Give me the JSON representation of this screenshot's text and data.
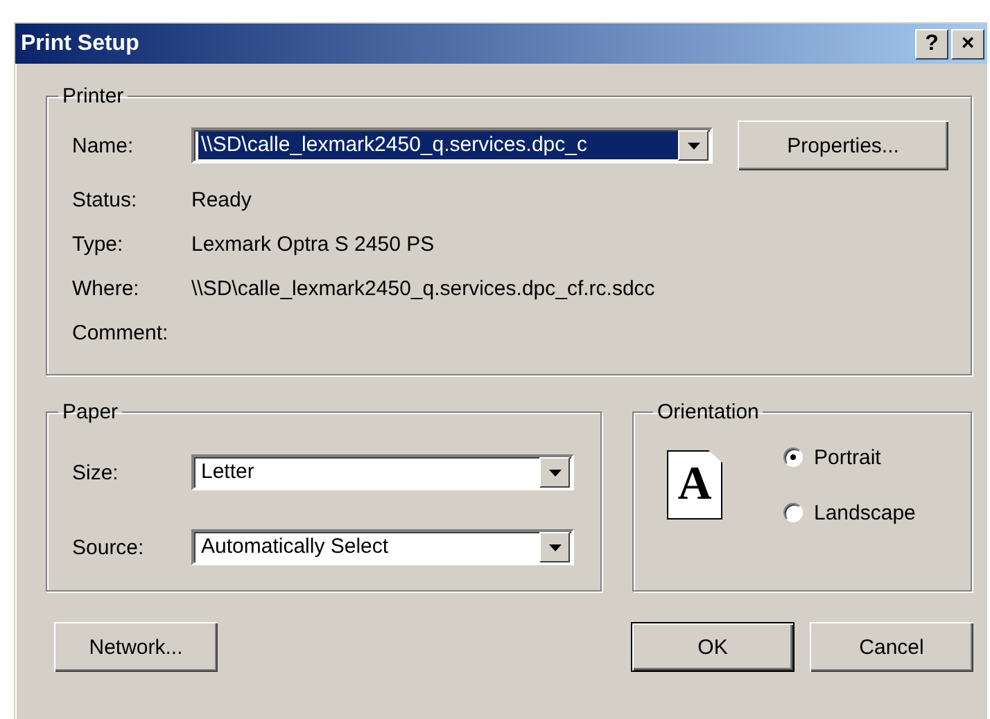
{
  "window": {
    "title": "Print Setup",
    "help_button": "?",
    "close_button": "×"
  },
  "printer": {
    "legend": "Printer",
    "name_label": "Name:",
    "name_value": "\\\\SD\\calle_lexmark2450_q.services.dpc_c",
    "name_focused": true,
    "properties_button": "Properties...",
    "info": [
      {
        "label": "Status:",
        "value": "Ready"
      },
      {
        "label": "Type:",
        "value": "Lexmark Optra S 2450 PS"
      },
      {
        "label": "Where:",
        "value": "\\\\SD\\calle_lexmark2450_q.services.dpc_cf.rc.sdcc"
      },
      {
        "label": "Comment:"
      }
    ]
  },
  "paper": {
    "legend": "Paper",
    "fields": [
      {
        "label": "Size:",
        "value": "Letter"
      },
      {
        "label": "Source:",
        "value": "Automatically Select"
      }
    ]
  },
  "orientation": {
    "legend": "Orientation",
    "preview_letter": "A",
    "options": [
      {
        "label": "Portrait",
        "selected": true
      },
      {
        "label": "Landscape",
        "selected": false
      }
    ]
  },
  "buttons": [
    {
      "label": "Network...",
      "default": false
    },
    {
      "label": "OK",
      "default": true
    },
    {
      "label": "Cancel",
      "default": false
    }
  ]
}
